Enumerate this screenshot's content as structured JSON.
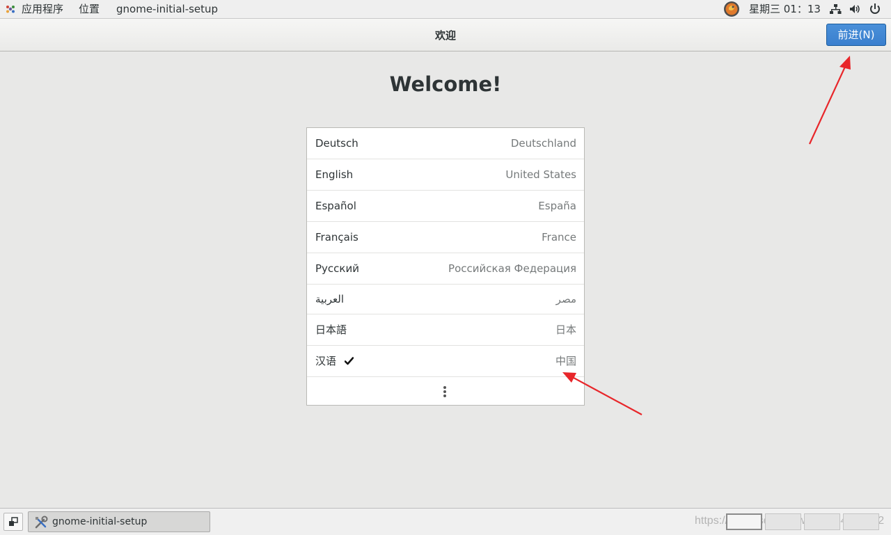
{
  "top_panel": {
    "applications": "应用程序",
    "places": "位置",
    "window_title": "gnome-initial-setup",
    "clock": "星期三  01：13",
    "icons": [
      "applications-icon",
      "clock-avatar-icon",
      "network-icon",
      "volume-icon",
      "power-icon"
    ]
  },
  "header": {
    "title": "欢迎",
    "next_button": "前进(N)"
  },
  "welcome": {
    "title": "Welcome!",
    "languages": [
      {
        "name": "Deutsch",
        "region": "Deutschland",
        "selected": false
      },
      {
        "name": "English",
        "region": "United States",
        "selected": false
      },
      {
        "name": "Español",
        "region": "España",
        "selected": false
      },
      {
        "name": "Français",
        "region": "France",
        "selected": false
      },
      {
        "name": "Русский",
        "region": "Российская Федерация",
        "selected": false
      },
      {
        "name": "العربية",
        "region": "مصر",
        "selected": false
      },
      {
        "name": "日本語",
        "region": "日本",
        "selected": false
      },
      {
        "name": "汉语",
        "region": "中国",
        "selected": true
      }
    ],
    "more_icon": "vertical-ellipsis-icon"
  },
  "taskbar": {
    "task_label": "gnome-initial-setup",
    "workspaces": 4,
    "watermark": "https://blog.csdn.net/weixin_44797182"
  },
  "colors": {
    "accent": "#3a7fce",
    "annotation_arrow": "#e8262a",
    "background": "#e8e8e7"
  }
}
